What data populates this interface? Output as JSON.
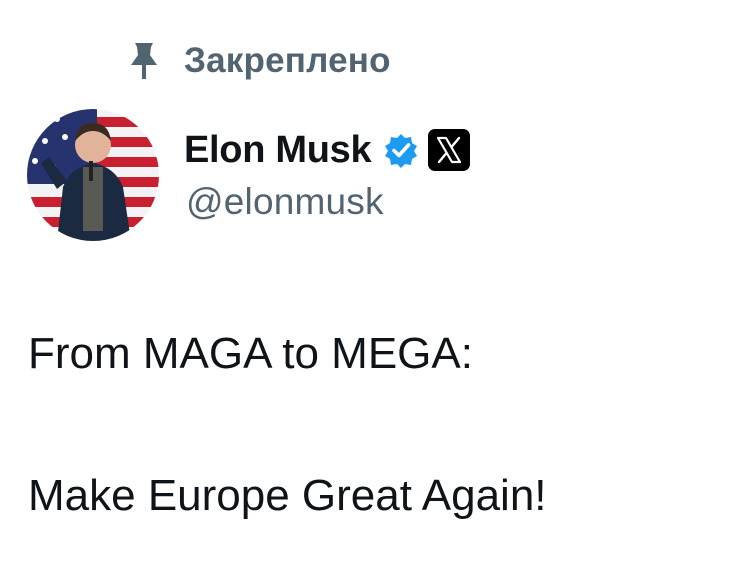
{
  "pinned": {
    "label": "Закреплено",
    "icon": "pin-icon"
  },
  "author": {
    "display_name": "Elon Musk",
    "handle": "@elonmusk",
    "verified_icon": "verified-badge-icon",
    "affiliate_icon": "x-logo-icon",
    "avatar": "avatar"
  },
  "tweet": {
    "lines": [
      "From MAGA to MEGA:",
      "",
      "Make Europe Great Again!"
    ]
  },
  "colors": {
    "text_primary": "#0f1419",
    "text_secondary": "#536471",
    "verified_blue": "#1d9bf0",
    "badge_black": "#000000"
  }
}
